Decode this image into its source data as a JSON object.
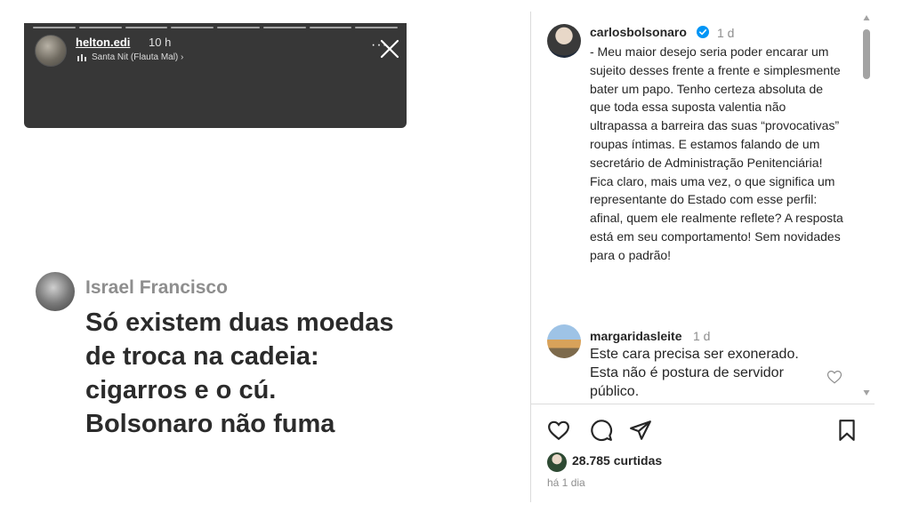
{
  "story": {
    "username": "helton.edi",
    "time": "10 h",
    "music": "Santa Nit (Flauta Mal) ›",
    "more": "···",
    "progress_segments": 8
  },
  "story_comment": {
    "username": "Israel Francisco",
    "text": "Só existem duas moedas de troca na cadeia: cigarros e o cú. Bolsonaro não fuma"
  },
  "post": {
    "author": {
      "username": "carlosbolsonaro",
      "verified": true,
      "time": "1 d",
      "caption": "- Meu maior desejo seria poder encarar um sujeito desses frente a frente e simplesmente bater um papo. Tenho certeza absoluta de que toda essa suposta valentia não ultrapassa a barreira das suas “provocativas” roupas íntimas. E estamos falando de um secretário de Administração Penitenciária! Fica claro, mais uma vez, o que significa um representante do Estado com esse perfil: afinal, quem ele realmente reflete? A resposta está em seu comportamento! Sem novidades para o padrão!"
    },
    "comments": [
      {
        "username": "margaridasleite",
        "time": "1 d",
        "text": "Este cara precisa ser exonerado. Esta não é postura de servidor público."
      }
    ],
    "actions": {
      "icons": [
        "heart-icon",
        "comment-icon",
        "share-icon",
        "bookmark-icon"
      ]
    },
    "likes": "28.785 curtidas",
    "date": "há 1 dia"
  },
  "colors": {
    "story_bg": "#373737",
    "verified": "#0095f6",
    "text": "#262626",
    "muted": "#8e8e8e"
  }
}
